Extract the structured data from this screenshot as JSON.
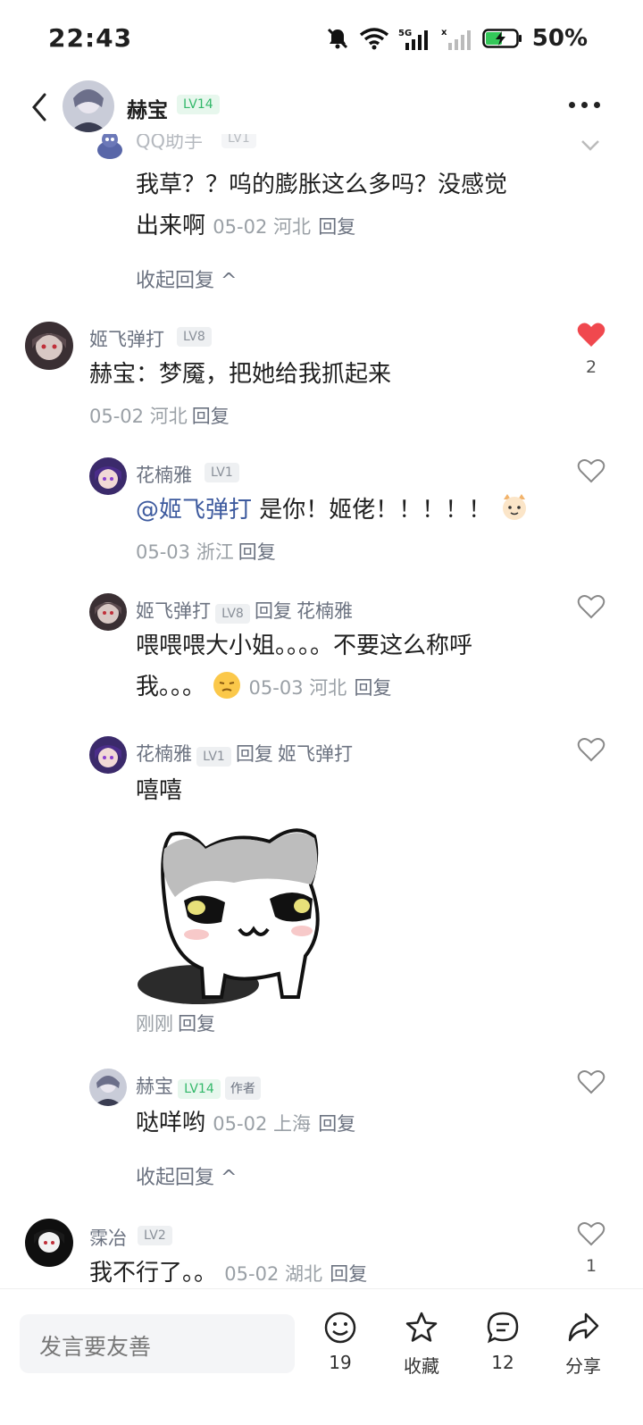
{
  "status_bar": {
    "time": "22:43",
    "battery": "50%"
  },
  "header": {
    "name": "赫宝",
    "level": "LV14",
    "more_icon": "more-dots-icon"
  },
  "thread1": {
    "top_name": "QQ助手",
    "top_level": "LV1",
    "reply_text_1": "我草？？呜的膨胀这么多吗？没感觉",
    "reply_text_2": "出来啊",
    "reply_meta": "05-02 河北",
    "reply_label": "回复",
    "collapse": "收起回复 ^"
  },
  "comment_jifei": {
    "name": "姬飞弹打",
    "level": "LV8",
    "text": "赫宝：梦魇，把她给我抓起来",
    "meta": "05-02 河北",
    "reply_label": "回复",
    "like_count": "2",
    "liked": true,
    "replies": [
      {
        "name": "花楠雅",
        "level": "LV1",
        "mention": "@姬飞弹打",
        "text": " 是你！姬佬！！！！！",
        "meta": "05-03 浙江",
        "reply_label": "回复"
      },
      {
        "name": "姬飞弹打",
        "level": "LV8",
        "reply_word": "回复",
        "reply_to": "花楠雅",
        "text_1": "喂喂喂大小姐。。。。不要这么称呼",
        "text_2": "我。。。",
        "meta": "05-03 河北",
        "reply_label": "回复"
      },
      {
        "name": "花楠雅",
        "level": "LV1",
        "reply_word": "回复",
        "reply_to": "姬飞弹打",
        "text": "嘻嘻",
        "meta": "刚刚",
        "reply_label": "回复"
      },
      {
        "name": "赫宝",
        "level": "LV14",
        "author_tag": "作者",
        "text": "哒咩哟",
        "meta": "05-02 上海",
        "reply_label": "回复"
      }
    ],
    "collapse": "收起回复 ^"
  },
  "comment_linye": {
    "name": "霂冶",
    "level": "LV2",
    "text": "我不行了。。",
    "meta": "05-02 湖北",
    "reply_label": "回复",
    "like_count": "1"
  },
  "bottom": {
    "placeholder": "发言要友善",
    "like_count": "19",
    "favorite_label": "收藏",
    "comment_count": "12",
    "share_label": "分享"
  },
  "colors": {
    "accent_green": "#33b86a",
    "heart_red": "#f0484e",
    "mention_blue": "#3d5a9e"
  }
}
